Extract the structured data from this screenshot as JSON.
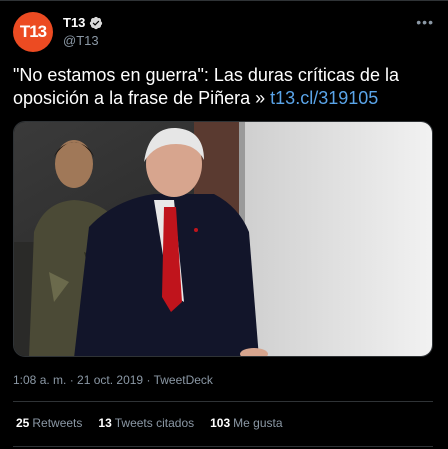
{
  "author": {
    "avatar_text": "T13",
    "display_name": "T13",
    "handle": "@T13",
    "avatar_color": "#ec4b22",
    "verified_icon": "verified-badge-icon"
  },
  "more_icon": "more-options-icon",
  "tweet": {
    "text": "\"No estamos en guerra\": Las duras críticas de la oposición a la frase de Piñera » ",
    "link": "t13.cl/319105"
  },
  "meta": {
    "time": "1:08 a. m.",
    "sep1": " · ",
    "date": "21 oct. 2019",
    "sep2": " · ",
    "source": "TweetDeck"
  },
  "stats": [
    {
      "count": "25",
      "label": "Retweets"
    },
    {
      "count": "13",
      "label": "Tweets citados"
    },
    {
      "count": "103",
      "label": "Me gusta"
    }
  ]
}
